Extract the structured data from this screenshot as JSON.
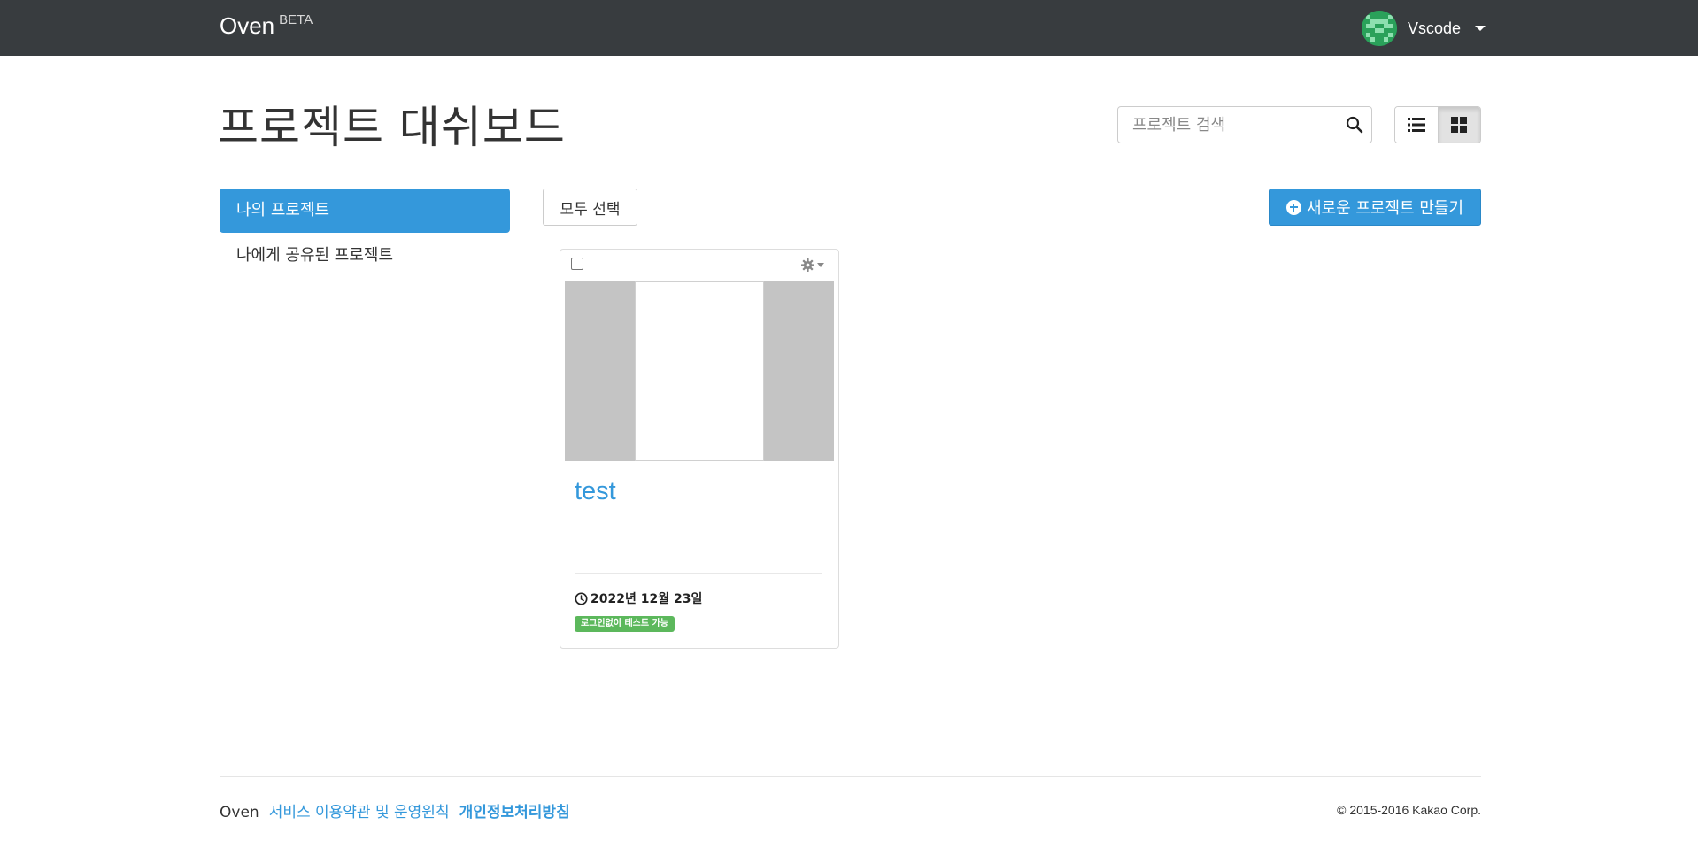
{
  "navbar": {
    "brand": "Oven",
    "beta": "BETA",
    "user_name": "Vscode"
  },
  "header": {
    "title": "프로젝트 대쉬보드",
    "search_placeholder": "프로젝트 검색"
  },
  "view_toggle": {
    "active": "grid"
  },
  "sidebar": {
    "items": [
      {
        "label": "나의 프로젝트",
        "active": true
      },
      {
        "label": "나에게 공유된 프로젝트",
        "active": false
      }
    ]
  },
  "toolbar": {
    "select_all": "모두 선택",
    "new_project": "새로운 프로젝트 만들기"
  },
  "projects": [
    {
      "title": "test",
      "date": "2022년 12월 23일",
      "badge": "로그인없이 테스트 가능",
      "checked": false
    }
  ],
  "footer": {
    "brand": "Oven",
    "terms": "서비스 이용약관 및 운영원칙",
    "privacy": "개인정보처리방침",
    "copyright": "© 2015-2016 Kakao Corp."
  },
  "colors": {
    "navbar": "#383c3f",
    "primary": "#3498db",
    "badge_green": "#5cb85c",
    "avatar_green": "#2aa15a"
  }
}
